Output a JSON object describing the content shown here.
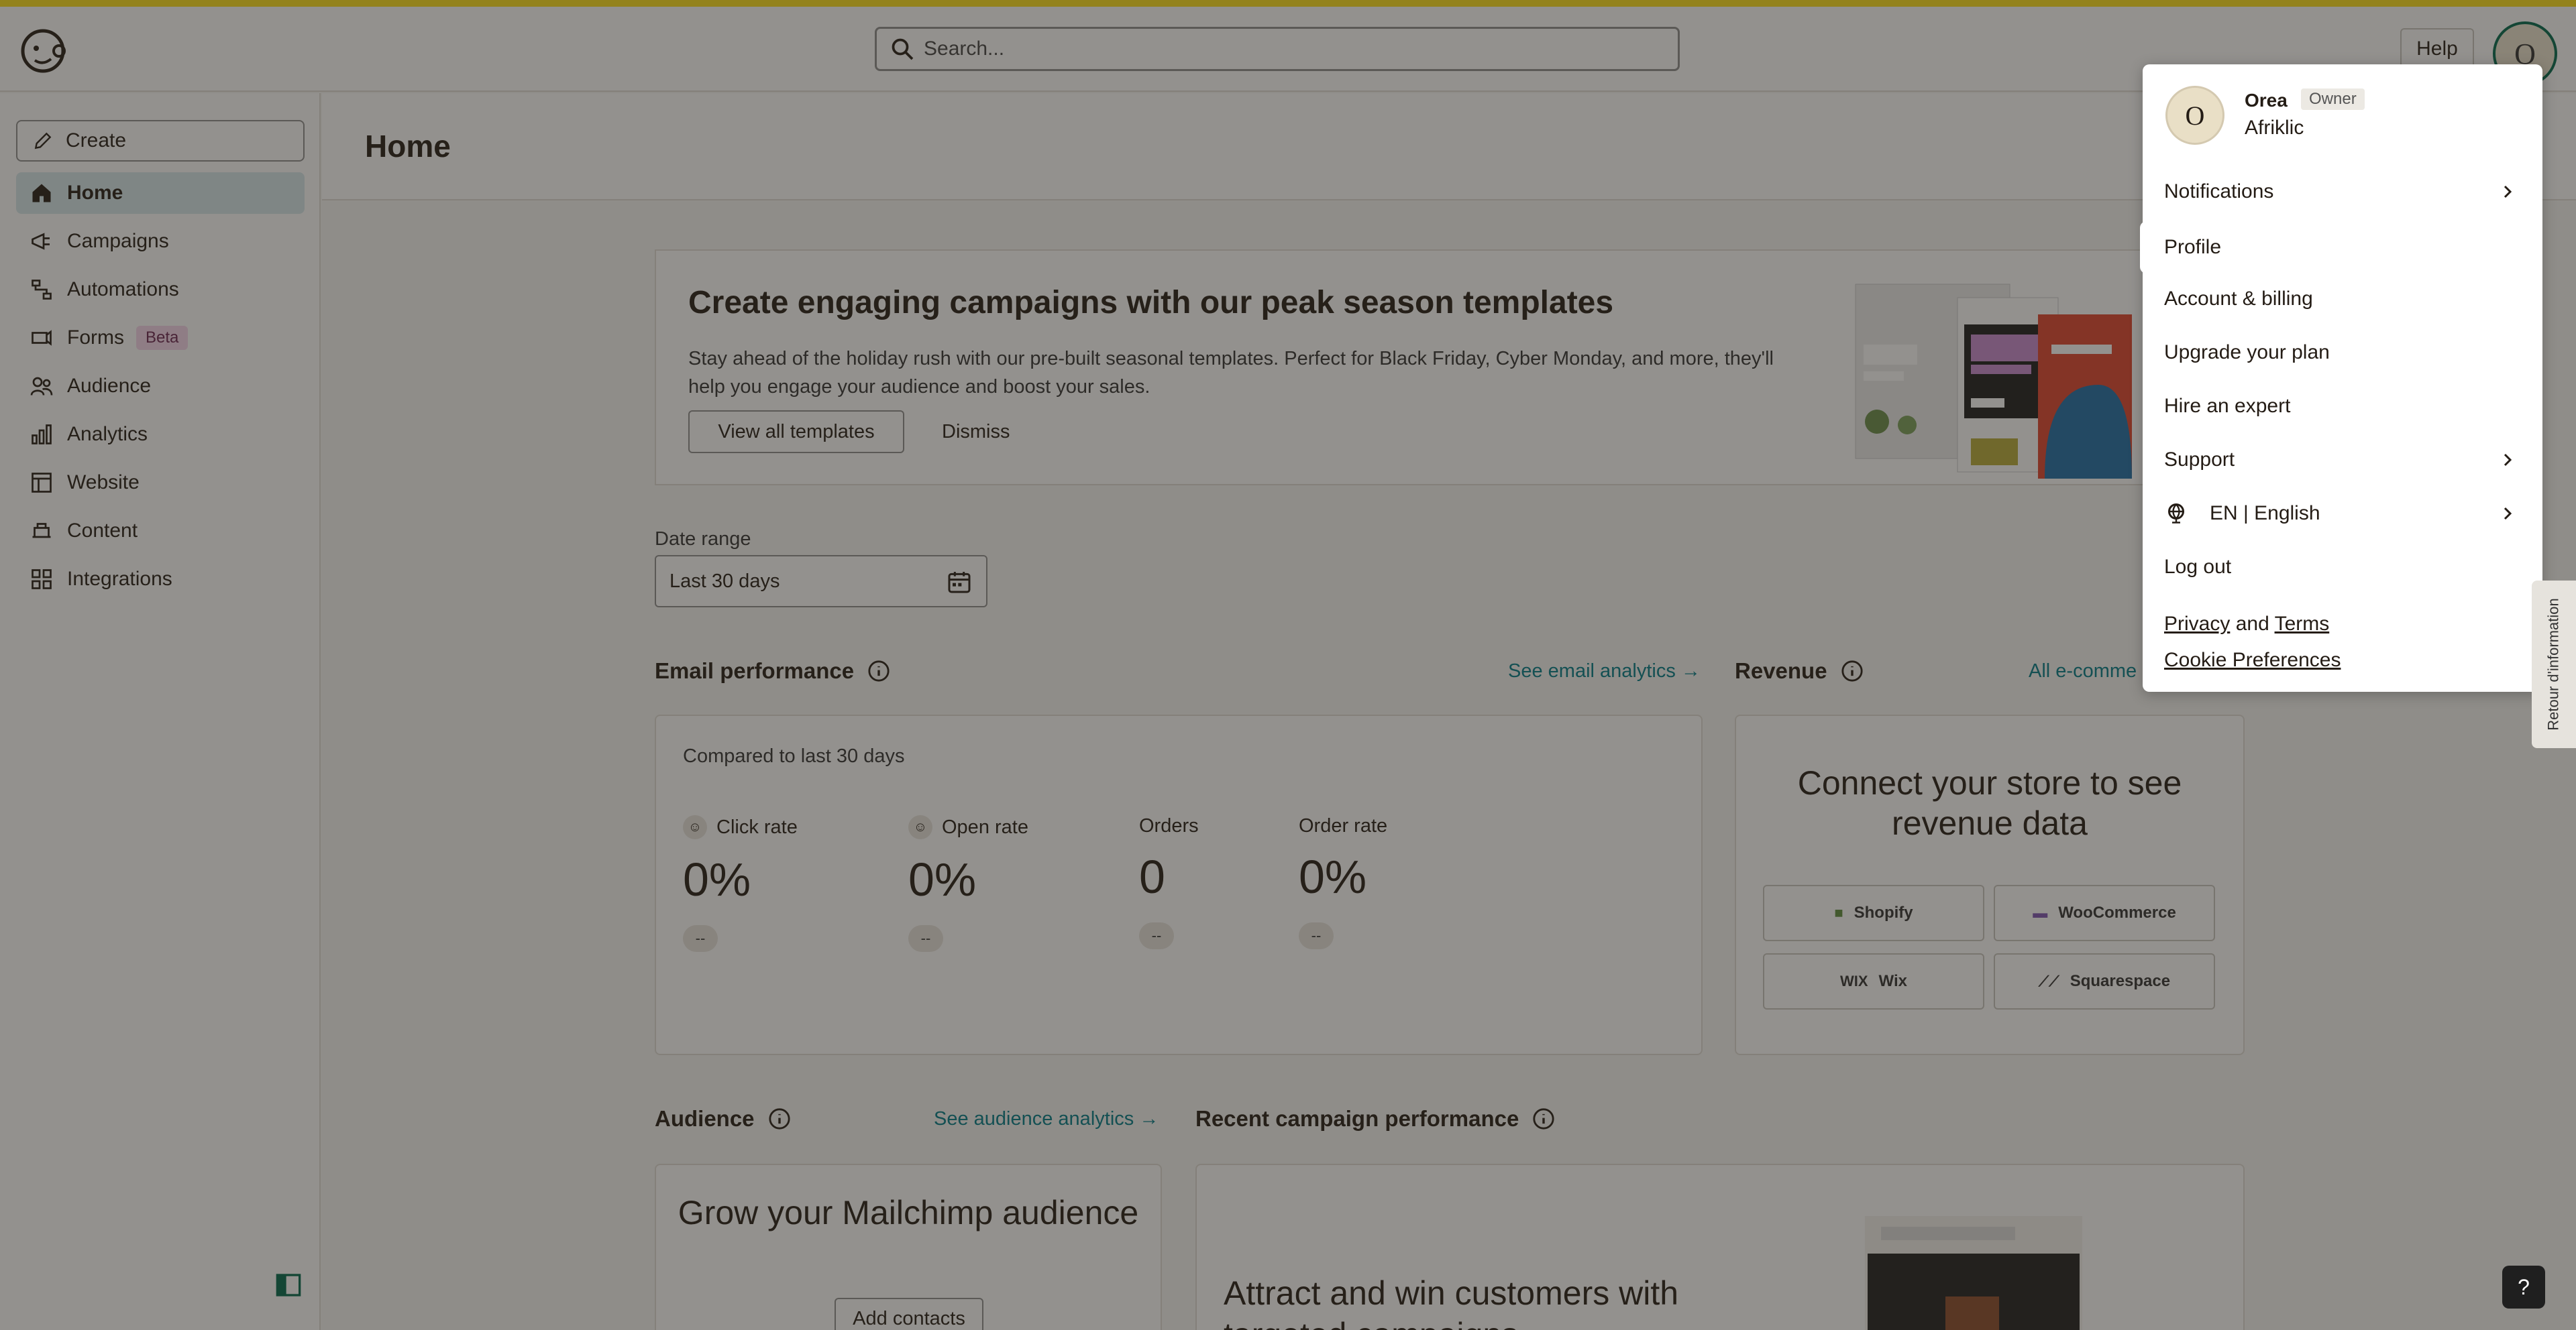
{
  "topbar": {
    "search_placeholder": "Search...",
    "help_label": "Help",
    "avatar_initial": "O"
  },
  "sidebar": {
    "create_label": "Create",
    "items": [
      {
        "label": "Home",
        "icon": "home-icon",
        "active": true
      },
      {
        "label": "Campaigns",
        "icon": "megaphone-icon"
      },
      {
        "label": "Automations",
        "icon": "flow-icon"
      },
      {
        "label": "Forms",
        "icon": "forms-icon",
        "badge": "Beta"
      },
      {
        "label": "Audience",
        "icon": "audience-icon"
      },
      {
        "label": "Analytics",
        "icon": "bar-chart-icon"
      },
      {
        "label": "Website",
        "icon": "website-icon"
      },
      {
        "label": "Content",
        "icon": "content-icon"
      },
      {
        "label": "Integrations",
        "icon": "grid-icon"
      }
    ]
  },
  "page": {
    "title": "Home"
  },
  "banner": {
    "title": "Create engaging campaigns with our peak season templates",
    "body": "Stay ahead of the holiday rush with our pre-built seasonal templates. Perfect for Black Friday, Cyber Monday, and more, they'll help you engage your audience and boost your sales.",
    "primary_label": "View all templates",
    "dismiss_label": "Dismiss"
  },
  "date_range": {
    "label": "Date range",
    "value": "Last 30 days"
  },
  "email_performance": {
    "title": "Email performance",
    "link": "See email analytics →",
    "compared": "Compared to last 30 days",
    "metrics": [
      {
        "label": "Click rate",
        "value": "0%",
        "change": "--"
      },
      {
        "label": "Open rate",
        "value": "0%",
        "change": "--"
      },
      {
        "label": "Orders",
        "value": "0",
        "change": "--"
      },
      {
        "label": "Order rate",
        "value": "0%",
        "change": "--"
      }
    ]
  },
  "revenue": {
    "title": "Revenue",
    "link": "All e-comme",
    "heading": "Connect your store to see revenue data",
    "stores": [
      {
        "name": "Shopify",
        "icon": "shopify-icon"
      },
      {
        "name": "WooCommerce",
        "icon": "woocommerce-icon"
      },
      {
        "name": "Wix",
        "icon": "wix-icon",
        "logo_text": "WIX"
      },
      {
        "name": "Squarespace",
        "icon": "squarespace-icon"
      }
    ]
  },
  "audience": {
    "title": "Audience",
    "link": "See audience analytics →",
    "heading": "Grow your Mailchimp audience",
    "button": "Add contacts"
  },
  "recent": {
    "title": "Recent campaign performance",
    "heading": "Attract and win customers with targeted campaigns"
  },
  "account_menu": {
    "name": "Orea",
    "role": "Owner",
    "org": "Afriklic",
    "avatar_initial": "O",
    "items": [
      {
        "label": "Notifications",
        "has_submenu": true
      },
      {
        "label": "Profile",
        "highlighted": true
      },
      {
        "label": "Account & billing"
      },
      {
        "label": "Upgrade your plan"
      },
      {
        "label": "Hire an expert"
      },
      {
        "label": "Support",
        "has_submenu": true
      },
      {
        "label": "EN | English",
        "has_submenu": true,
        "icon": "globe-icon"
      },
      {
        "label": "Log out"
      }
    ],
    "privacy": "Privacy",
    "and": "and",
    "terms": "Terms",
    "cookies": "Cookie Preferences"
  },
  "feedback_tab": "Retour d'information",
  "help_fab": "?",
  "colors": {
    "accent_yellow": "#ffe01b",
    "link_teal": "#007c89",
    "active_nav": "#d7e8ec"
  }
}
